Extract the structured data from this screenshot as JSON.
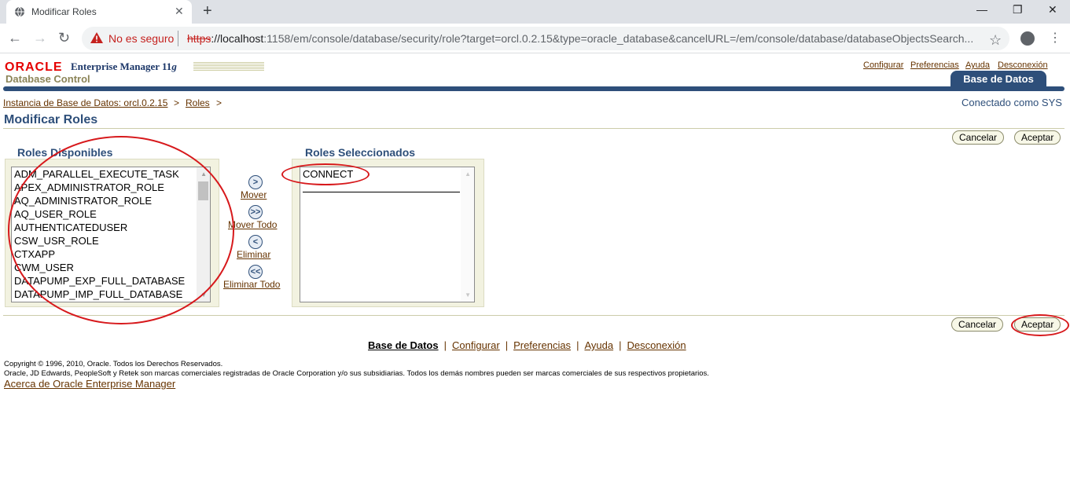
{
  "browser": {
    "tab_title": "Modificar Roles",
    "not_secure": "No es seguro",
    "url_scheme": "https",
    "url_host": "://localhost",
    "url_rest": ":1158/em/console/database/security/role?target=orcl.0.2.15&type=oracle_database&cancelURL=/em/console/database/databaseObjectsSearch..."
  },
  "header": {
    "oracle_logo": "ORACLE",
    "product": "Enterprise Manager 11",
    "product_suffix": "g",
    "subproduct": "Database Control",
    "global_links": [
      "Configurar",
      "Preferencias",
      "Ayuda",
      "Desconexión"
    ],
    "active_tab": "Base de Datos"
  },
  "breadcrumb": {
    "items": [
      "Instancia de Base de Datos: orcl.0.2.15",
      "Roles"
    ],
    "separator": ">"
  },
  "connected_as": "Conectado como SYS",
  "page_title": "Modificar Roles",
  "buttons": {
    "cancel": "Cancelar",
    "accept": "Aceptar"
  },
  "available": {
    "title": "Roles Disponibles",
    "items": [
      "ADM_PARALLEL_EXECUTE_TASK",
      "APEX_ADMINISTRATOR_ROLE",
      "AQ_ADMINISTRATOR_ROLE",
      "AQ_USER_ROLE",
      "AUTHENTICATEDUSER",
      "CSW_USR_ROLE",
      "CTXAPP",
      "CWM_USER",
      "DATAPUMP_EXP_FULL_DATABASE",
      "DATAPUMP_IMP_FULL_DATABASE"
    ]
  },
  "selected": {
    "title": "Roles Seleccionados",
    "items": [
      "CONNECT"
    ]
  },
  "shuttle": {
    "move": {
      "icon": ">",
      "label": "Mover"
    },
    "move_all": {
      "icon": ">>",
      "label": "Mover Todo"
    },
    "remove": {
      "icon": "<",
      "label": "Eliminar"
    },
    "remove_all": {
      "icon": "<<",
      "label": "Eliminar Todo"
    }
  },
  "footer": {
    "links": [
      "Base de Datos",
      "Configurar",
      "Preferencias",
      "Ayuda",
      "Desconexión"
    ],
    "copyright_1": "Copyright © 1996, 2010, Oracle. Todos los Derechos Reservados.",
    "copyright_2": "Oracle, JD Edwards, PeopleSoft y Retek son marcas comerciales registradas de Oracle Corporation y/o sus subsidiarias. Todos los demás nombres pueden ser marcas comerciales de sus respectivos propietarios.",
    "about": "Acerca de Oracle Enterprise Manager"
  },
  "colors": {
    "brand_blue": "#2e4f7a",
    "link_brown": "#663300",
    "oracle_red": "#e50000",
    "annotation_red": "#d7191c"
  }
}
